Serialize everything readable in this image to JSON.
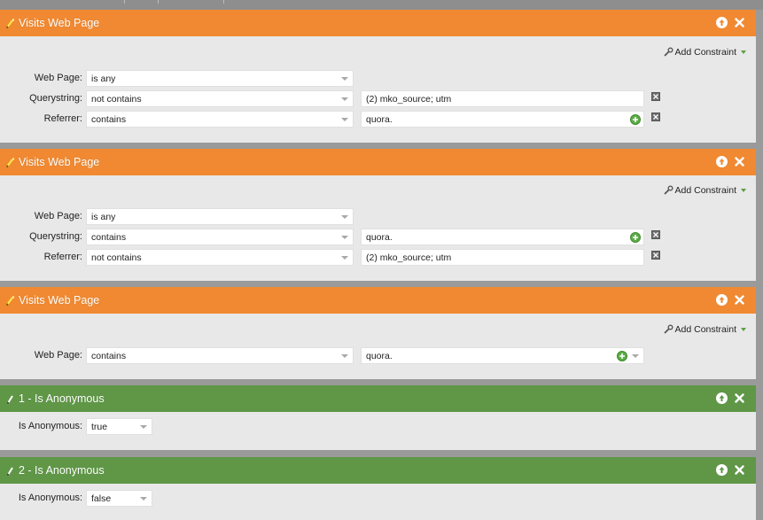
{
  "colors": {
    "orange": "#f08931",
    "green": "#5f9747",
    "panel_bg": "#e8e8e8"
  },
  "icons": {
    "filter_orange": "pencil-wand-icon",
    "filter_green": "pencil-icon",
    "move_up": "arrow-up-circle-icon",
    "remove": "close-x-icon",
    "add_constraint": "wrench-icon",
    "add_value": "plus-circle-icon",
    "delete_row": "square-x-icon"
  },
  "filters": [
    {
      "title": "Visits Web Page",
      "add_constraint": "Add Constraint",
      "rows": [
        {
          "label": "Web Page:",
          "operator": "is any"
        },
        {
          "label": "Querystring:",
          "operator": "not contains",
          "value": "(2) mko_source; utm"
        },
        {
          "label": "Referrer:",
          "operator": "contains",
          "value": "quora."
        }
      ]
    },
    {
      "title": "Visits Web Page",
      "add_constraint": "Add Constraint",
      "rows": [
        {
          "label": "Web Page:",
          "operator": "is any"
        },
        {
          "label": "Querystring:",
          "operator": "contains",
          "value": "quora."
        },
        {
          "label": "Referrer:",
          "operator": "not contains",
          "value": "(2) mko_source; utm"
        }
      ]
    },
    {
      "title": "Visits Web Page",
      "add_constraint": "Add Constraint",
      "rows": [
        {
          "label": "Web Page:",
          "operator": "contains",
          "value": "quora."
        }
      ]
    },
    {
      "title": "1 - Is Anonymous",
      "rows": [
        {
          "label": "Is Anonymous:",
          "operator": "true"
        }
      ]
    },
    {
      "title": "2 - Is Anonymous",
      "rows": [
        {
          "label": "Is Anonymous:",
          "operator": "false"
        }
      ]
    }
  ]
}
